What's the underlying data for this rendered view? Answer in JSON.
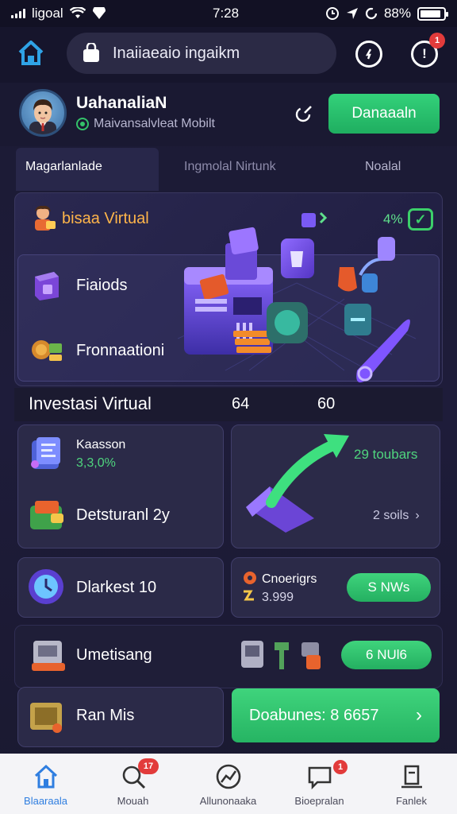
{
  "status_bar": {
    "carrier": "ligoal",
    "time": "7:28",
    "battery": "88%",
    "battery_level": 0.88
  },
  "header": {
    "search_text": "Inaiiaeaio ingaikm",
    "notification_count": "1"
  },
  "profile": {
    "name": "UahanaliaN",
    "subtitle": "Maivansalvleat Mobilt",
    "action_button": "Danaaaln"
  },
  "tabs": [
    {
      "label": "Magarlanlade",
      "active": true
    },
    {
      "label": "Ingmolal Nirtunk",
      "active": false
    },
    {
      "label": "Noalal",
      "active": false
    }
  ],
  "banner": {
    "title": "bisaa Virtual",
    "percent": "4%",
    "items": [
      {
        "label": "Fiaiods",
        "icon": "cube-icon"
      },
      {
        "label": "Fronnaationi",
        "icon": "coins-icon"
      }
    ]
  },
  "investasi": {
    "title": "Investasi Virtual",
    "stat_a": "64",
    "stat_b": "60"
  },
  "cards": {
    "saving": {
      "label": "Kaasson",
      "value": "3,3,0%"
    },
    "trend": {
      "label": "29 toubars",
      "link": "2 soils"
    },
    "deposit": {
      "label": "Detsturanl 2y"
    },
    "bonus": {
      "label": "Dlarkest 10"
    },
    "energy": {
      "label": "Cnoerigrs",
      "value": "3.999",
      "button": "S NWs"
    },
    "umetisang": {
      "label": "Umetisang",
      "button": "6 NUl6"
    },
    "ranmis": {
      "label": "Ran Mis",
      "button": "Doabunes: 8 6657"
    }
  },
  "bottom_nav": [
    {
      "label": "Blaaraala",
      "icon": "home-icon",
      "active": true,
      "badge": ""
    },
    {
      "label": "Mouah",
      "icon": "search-icon",
      "active": false,
      "badge": "17"
    },
    {
      "label": "Allunonaaka",
      "icon": "chart-icon",
      "active": false,
      "badge": ""
    },
    {
      "label": "Bioepralan",
      "icon": "message-icon",
      "active": false,
      "badge": "1"
    },
    {
      "label": "Fanlek",
      "icon": "profile-icon",
      "active": false,
      "badge": ""
    }
  ],
  "colors": {
    "accent_green": "#2fc46f",
    "accent_orange": "#ffb54a",
    "background": "#1b1a33",
    "nav_active": "#2f7ee0"
  }
}
